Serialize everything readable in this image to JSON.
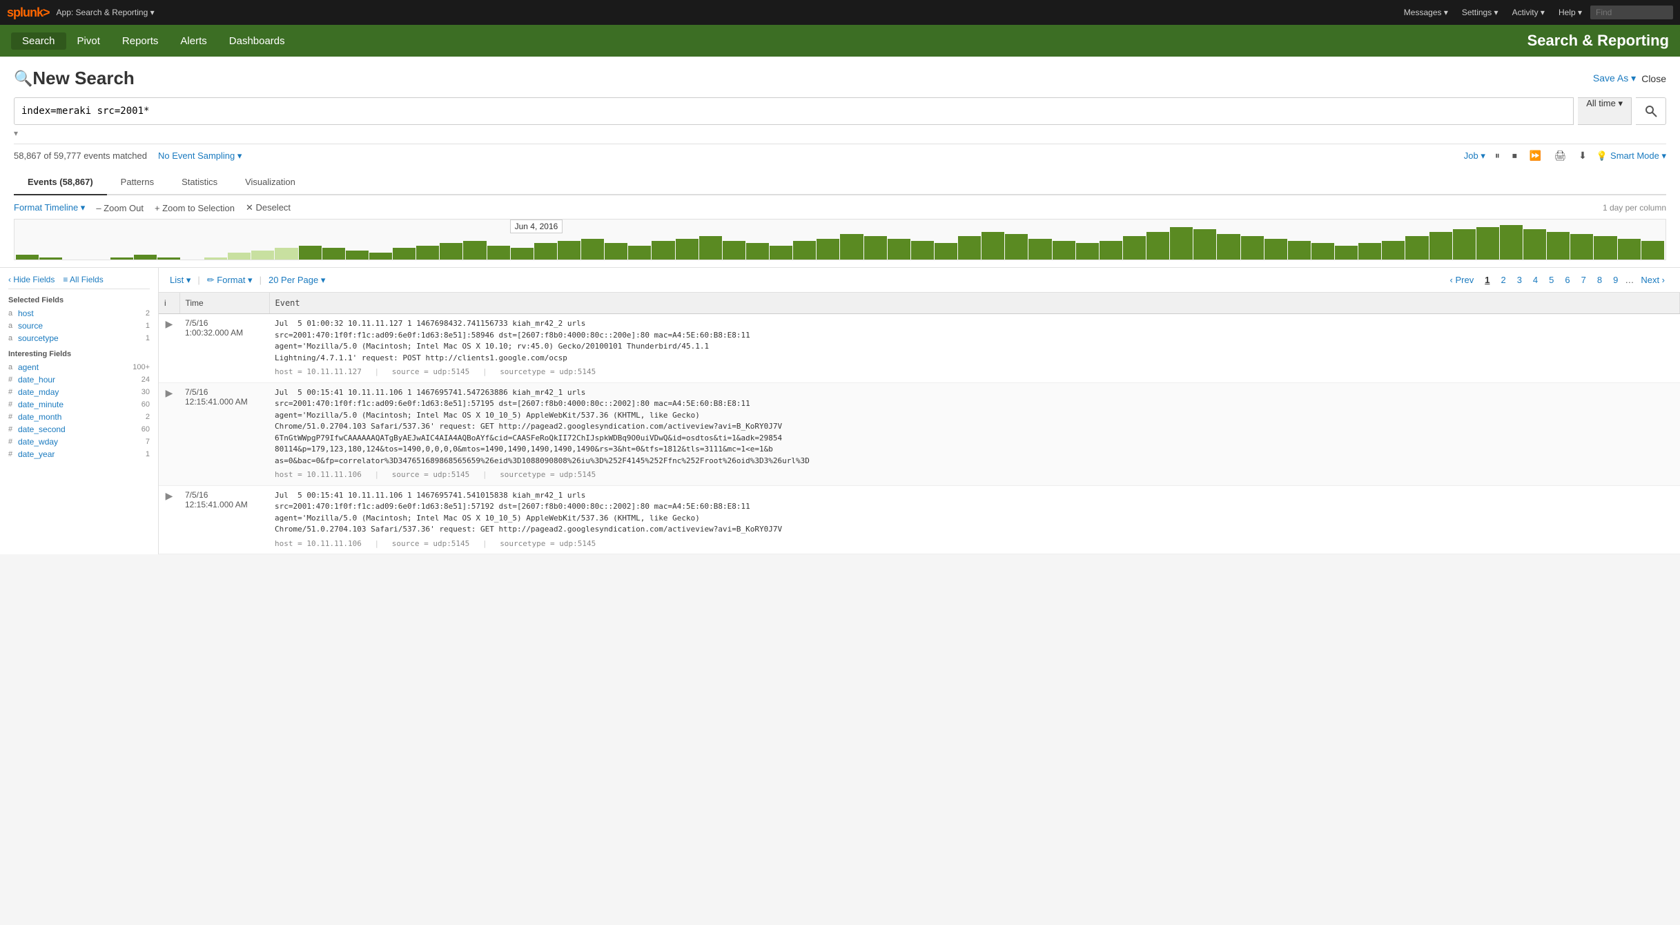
{
  "topnav": {
    "logo": "splunk>",
    "app_name": "App: Search & Reporting ▾",
    "messages_label": "Messages ▾",
    "settings_label": "Settings ▾",
    "activity_label": "Activity ▾",
    "help_label": "Help ▾",
    "find_placeholder": "Find"
  },
  "secnav": {
    "items": [
      {
        "label": "Search",
        "active": true
      },
      {
        "label": "Pivot",
        "active": false
      },
      {
        "label": "Reports",
        "active": false
      },
      {
        "label": "Alerts",
        "active": false
      },
      {
        "label": "Dashboards",
        "active": false
      }
    ],
    "title": "Search & Reporting"
  },
  "page": {
    "title": "New Search",
    "save_as_label": "Save As ▾",
    "close_label": "Close"
  },
  "search": {
    "query": "index=meraki src=2001*",
    "time_range": "All time ▾",
    "placeholder": "Search"
  },
  "results": {
    "summary": "58,867 of 59,777 events matched",
    "sampling": "No Event Sampling ▾",
    "job_label": "Job ▾",
    "smart_mode_label": "Smart Mode ▾"
  },
  "tabs": [
    {
      "label": "Events (58,867)",
      "active": true
    },
    {
      "label": "Patterns",
      "active": false
    },
    {
      "label": "Statistics",
      "active": false
    },
    {
      "label": "Visualization",
      "active": false
    }
  ],
  "timeline": {
    "format_label": "Format Timeline ▾",
    "zoom_out_label": "– Zoom Out",
    "zoom_selection_label": "+ Zoom to Selection",
    "deselect_label": "✕ Deselect",
    "scale_label": "1 day per column",
    "tooltip": "Jun 4, 2016",
    "bars": [
      2,
      1,
      0,
      0,
      1,
      2,
      1,
      0,
      1,
      3,
      4,
      5,
      6,
      5,
      4,
      3,
      5,
      6,
      7,
      8,
      6,
      5,
      7,
      8,
      9,
      7,
      6,
      8,
      9,
      10,
      8,
      7,
      6,
      8,
      9,
      11,
      10,
      9,
      8,
      7,
      10,
      12,
      11,
      9,
      8,
      7,
      8,
      10,
      12,
      14,
      13,
      11,
      10,
      9,
      8,
      7,
      6,
      7,
      8,
      10,
      12,
      13,
      14,
      15,
      13,
      12,
      11,
      10,
      9,
      8
    ],
    "selected_bars": [
      8,
      9,
      10,
      11
    ]
  },
  "pagination": {
    "list_label": "List ▾",
    "format_label": "✏ Format ▾",
    "perpage_label": "20 Per Page ▾",
    "prev_label": "‹ Prev",
    "next_label": "Next ›",
    "current_page": 1,
    "pages": [
      "1",
      "2",
      "3",
      "4",
      "5",
      "6",
      "7",
      "8",
      "9"
    ]
  },
  "table_headers": {
    "i": "i",
    "time": "Time",
    "event": "Event"
  },
  "fields_sidebar": {
    "hide_fields_label": "‹ Hide Fields",
    "all_fields_label": "≡ All Fields",
    "selected_title": "Selected Fields",
    "selected_fields": [
      {
        "type": "a",
        "name": "host",
        "count": "2"
      },
      {
        "type": "a",
        "name": "source",
        "count": "1"
      },
      {
        "type": "a",
        "name": "sourcetype",
        "count": "1"
      }
    ],
    "interesting_title": "Interesting Fields",
    "interesting_fields": [
      {
        "type": "a",
        "name": "agent",
        "count": "100+"
      },
      {
        "type": "#",
        "name": "date_hour",
        "count": "24"
      },
      {
        "type": "#",
        "name": "date_mday",
        "count": "30"
      },
      {
        "type": "#",
        "name": "date_minute",
        "count": "60"
      },
      {
        "type": "#",
        "name": "date_month",
        "count": "2"
      },
      {
        "type": "#",
        "name": "date_second",
        "count": "60"
      },
      {
        "type": "#",
        "name": "date_wday",
        "count": "7"
      },
      {
        "type": "#",
        "name": "date_year",
        "count": "1"
      }
    ]
  },
  "events": [
    {
      "time": "7/5/16\n1:00:32.000 AM",
      "event_text": "Jul  5 01:00:32 10.11.11.127 1 1467698432.741156733 kiah_mr42_2 urls\nsrc=2001:470:1f0f:f1c:ad09:6e0f:1d63:8e51]:58946 dst=[2607:f8b0:4000:80c::200e]:80 mac=A4:5E:60:B8:E8:11\nagent='Mozilla/5.0 (Macintosh; Intel Mac OS X 10.10; rv:45.0) Gecko/20100101 Thunderbird/45.1.1\nLightning/4.7.1.1' request: POST http://clients1.google.com/ocsp",
      "meta_host": "host = 10.11.11.127",
      "meta_source": "source = udp:5145",
      "meta_sourcetype": "sourcetype = udp:5145"
    },
    {
      "time": "7/5/16\n12:15:41.000 AM",
      "event_text": "Jul  5 00:15:41 10.11.11.106 1 1467695741.547263886 kiah_mr42_1 urls\nsrc=2001:470:1f0f:f1c:ad09:6e0f:1d63:8e51]:57195 dst=[2607:f8b0:4000:80c::2002]:80 mac=A4:5E:60:B8:E8:11\nagent='Mozilla/5.0 (Macintosh; Intel Mac OS X 10_10_5) AppleWebKit/537.36 (KHTML, like Gecko)\nChrome/51.0.2704.103 Safari/537.36' request: GET http://pagead2.googlesyndication.com/activeview?avi=B_KoRY0J7V\n6TnGtWWpgP79IfwCAAAAAAQATgByAEJwAIC4AIA4AQBoAYf&cid=CAASFeRoQkII72ChIJspkWDBq9O0uiVDwQ&id=osdtos&ti=1&adk=29854\n80114&p=179,123,180,124&tos=1490,0,0,0,0&mtos=1490,1490,1490,1490,1490&rs=3&ht=0&tfs=1812&tls=3111&mc=1&lte=1&b\nas=0&bac=0&fp=correlator%3D347651689868565659%26eid%3D1088090808%26iu%3D%252F4145%252Ffnc%252Froot%26oid%3D3%26url%3D",
      "meta_host": "host = 10.11.11.106",
      "meta_source": "source = udp:5145",
      "meta_sourcetype": "sourcetype = udp:5145"
    },
    {
      "time": "7/5/16\n12:15:41.000 AM",
      "event_text": "Jul  5 00:15:41 10.11.11.106 1 1467695741.541015838 kiah_mr42_1 urls\nsrc=2001:470:1f0f:f1c:ad09:6e0f:1d63:8e51]:57192 dst=[2607:f8b0:4000:80c::2002]:80 mac=A4:5E:60:B8:E8:11\nagent='Mozilla/5.0 (Macintosh; Intel Mac OS X 10_10_5) AppleWebKit/537.36 (KHTML, like Gecko)\nChrome/51.0.2704.103 Safari/537.36' request: GET http://pagead2.googlesyndication.com/activeview?avi=B_KoRY0J7V",
      "meta_host": "host = 10.11.11.106",
      "meta_source": "source = udp:5145",
      "meta_sourcetype": "sourcetype = udp:5145"
    }
  ],
  "colors": {
    "green_nav": "#3c6e24",
    "blue_link": "#1a7abf",
    "bar_green": "#5a8a22",
    "bar_selected": "#c8e0a0"
  }
}
